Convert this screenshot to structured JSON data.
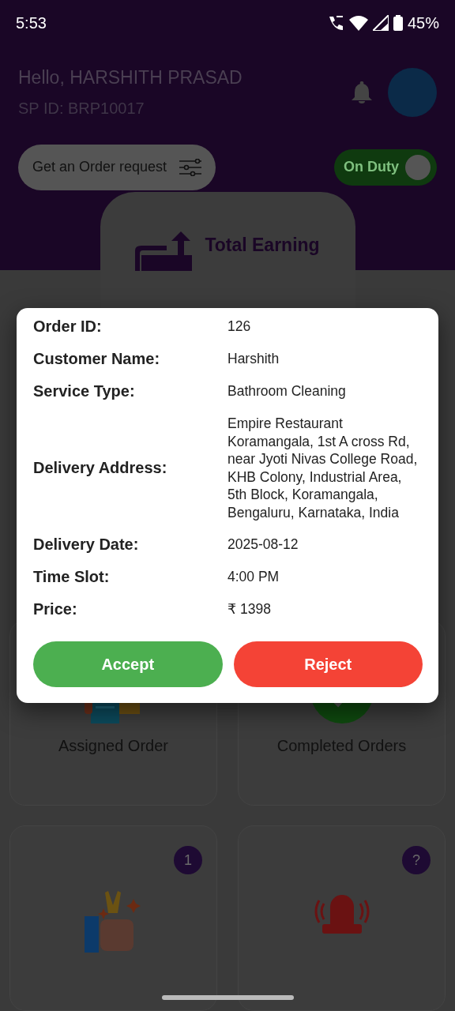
{
  "status_bar": {
    "time": "5:53",
    "battery": "45%"
  },
  "header": {
    "greeting": "Hello, HARSHITH PRASAD",
    "sp_id": "SP ID: BRP10017",
    "order_request_button": "Get an Order request",
    "duty_toggle": {
      "label": "On Duty",
      "on": true
    }
  },
  "earning_card": {
    "title": "Total Earning"
  },
  "dialog": {
    "fields": [
      {
        "label": "Order ID:",
        "value": "126"
      },
      {
        "label": "Customer Name:",
        "value": "Harshith"
      },
      {
        "label": "Service Type:",
        "value": "Bathroom Cleaning"
      },
      {
        "label": "Delivery Address:",
        "value": "Empire Restaurant Koramangala, 1st A cross Rd, near Jyoti Nivas College Road, KHB Colony, Industrial Area, 5th Block, Koramangala, Bengaluru, Karnataka, India"
      },
      {
        "label": "Delivery Date:",
        "value": "2025-08-12"
      },
      {
        "label": "Time Slot:",
        "value": "4:00 PM"
      },
      {
        "label": "Price:",
        "value": "₹ 1398"
      }
    ],
    "actions": [
      {
        "label": "Accept",
        "kind": "accept"
      },
      {
        "label": "Reject",
        "kind": "reject"
      }
    ]
  },
  "tiles": [
    {
      "kind": "assigned",
      "label": "Assigned Order"
    },
    {
      "kind": "completed",
      "label": "Completed Orders"
    },
    {
      "kind": "service",
      "badge": "1"
    },
    {
      "kind": "alert",
      "badge": "?"
    }
  ]
}
